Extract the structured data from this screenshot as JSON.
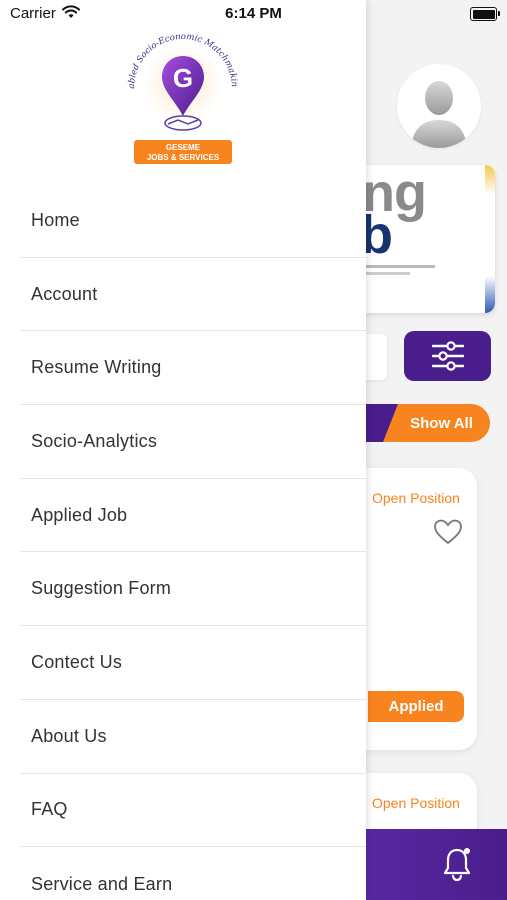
{
  "status_bar": {
    "carrier": "Carrier",
    "time": "6:14 PM"
  },
  "drawer": {
    "logo": {
      "arc_text": "Geo-Enabled Socio-Economic Matchmaking Effort",
      "name": "GESEME",
      "tagline": "JOBS & SERVICES"
    },
    "menu": [
      {
        "label": "Home"
      },
      {
        "label": "Account"
      },
      {
        "label": "Resume Writing"
      },
      {
        "label": "Socio-Analytics"
      },
      {
        "label": "Applied Job"
      },
      {
        "label": "Suggestion Form"
      },
      {
        "label": "Contect Us"
      },
      {
        "label": "About Us"
      },
      {
        "label": "FAQ"
      },
      {
        "label": "Service and Earn"
      }
    ]
  },
  "home": {
    "banner": {
      "word_top": "ng",
      "word_bottom": "b"
    },
    "show_all_label": "Show All",
    "job_card": {
      "status": "Open Position",
      "applied_label": "Applied"
    },
    "job_card_2": {
      "status": "Open Position"
    }
  },
  "colors": {
    "brand_purple": "#4a1d8c",
    "accent_orange": "#f7841e"
  }
}
